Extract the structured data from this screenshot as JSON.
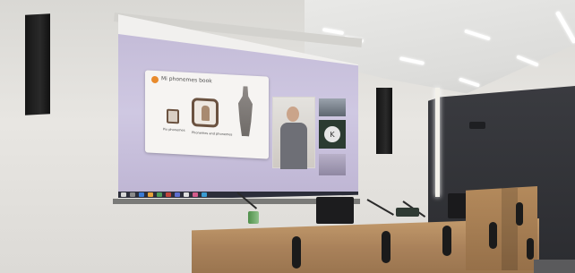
{
  "slide": {
    "heading": "Mi phonemes book",
    "caption_left": "Pix phonemes",
    "caption_center": "Phonemes and phonemes"
  },
  "presenter_caption": "K",
  "colors": {
    "wall": "#e6e4e0",
    "ceiling": "#ececea",
    "screen_bg": "#c7c0dc",
    "slide_bg": "#f6f4f2",
    "taskbar": "#2c2e3a",
    "wood": "#b48a5c",
    "dark_panel": "#2f3034",
    "accent_orange": "#e88a2c"
  }
}
